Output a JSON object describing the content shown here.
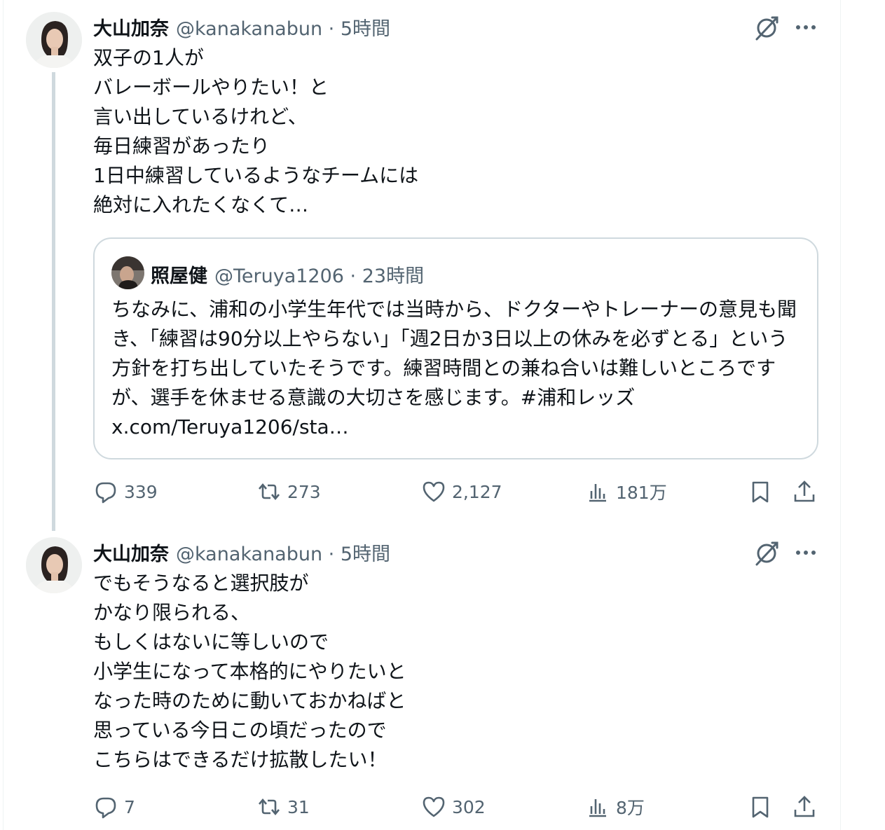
{
  "posts": [
    {
      "author": {
        "name": "大山加奈",
        "handle": "@kanakanabun",
        "meta": "@kanakanabun · 5時間"
      },
      "text": "双子の1人が\nバレーボールやりたい！と\n言い出しているけれど、\n毎日練習があったり\n1日中練習しているようなチームには\n絶対に入れたくなくて…",
      "quote": {
        "name": "照屋健",
        "meta": "@Teruya1206 · 23時間",
        "text": "ちなみに、浦和の小学生年代では当時から、ドクターやトレーナーの意見も聞き、「練習は90分以上やらない」「週2日か3日以上の休みを必ずとる」という方針を打ち出していたそうです。練習時間との兼ね合いは難しいところですが、選手を休ませる意識の大切さを感じます。#浦和レッズ x.com/Teruya1206/sta…"
      },
      "stats": {
        "replies": "339",
        "reposts": "273",
        "likes": "2,127",
        "views": "181万"
      }
    },
    {
      "author": {
        "name": "大山加奈",
        "handle": "@kanakanabun",
        "meta": "@kanakanabun · 5時間"
      },
      "text": "でもそうなると選択肢が\nかなり限られる、\nもしくはないに等しいので\n小学生になって本格的にやりたいと\nなった時のために動いておかねばと\n思っている今日この頃だったので\nこちらはできるだけ拡散したい！",
      "stats": {
        "replies": "7",
        "reposts": "31",
        "likes": "302",
        "views": "8万"
      }
    }
  ],
  "icons": {
    "reply": "reply-icon",
    "repost": "repost-icon",
    "like": "heart-icon",
    "views": "views-icon",
    "bookmark": "bookmark-icon",
    "share": "share-icon",
    "grok": "grok-icon",
    "more": "more-icon"
  },
  "colors": {
    "text_primary": "#0f1419",
    "text_secondary": "#536471",
    "border": "#cfd9de",
    "background": "#ffffff"
  }
}
